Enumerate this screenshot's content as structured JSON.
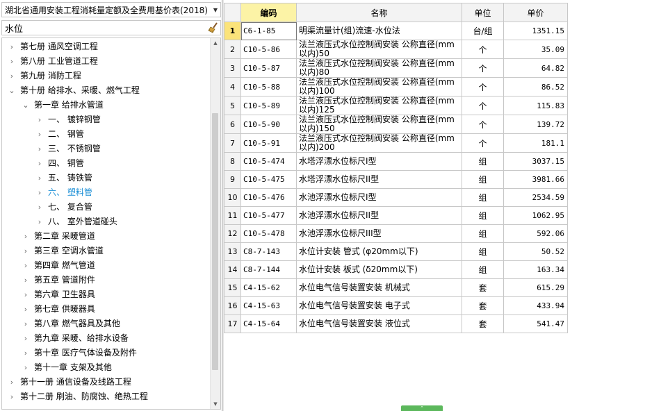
{
  "left_panel": {
    "quota_select": {
      "value": "湖北省通用安装工程消耗量定额及全费用基价表(2018)"
    },
    "search": {
      "value": "水位"
    },
    "tree": [
      {
        "label": "第七册  通风空调工程",
        "level": 0,
        "toggle": "›"
      },
      {
        "label": "第八册  工业管道工程",
        "level": 0,
        "toggle": "›"
      },
      {
        "label": "第九册  消防工程",
        "level": 0,
        "toggle": "›"
      },
      {
        "label": "第十册  给排水、采暖、燃气工程",
        "level": 0,
        "toggle": "⌄"
      },
      {
        "label": "第一章  给排水管道",
        "level": 1,
        "toggle": "⌄"
      },
      {
        "label": "一、  镀锌钢管",
        "level": 2,
        "toggle": "›"
      },
      {
        "label": "二、  钢管",
        "level": 2,
        "toggle": "›"
      },
      {
        "label": "三、  不锈钢管",
        "level": 2,
        "toggle": "›"
      },
      {
        "label": "四、  铜管",
        "level": 2,
        "toggle": "›"
      },
      {
        "label": "五、  铸铁管",
        "level": 2,
        "toggle": "›"
      },
      {
        "label": "六、  塑料管",
        "level": 2,
        "toggle": "›",
        "active": true
      },
      {
        "label": "七、  复合管",
        "level": 2,
        "toggle": "›"
      },
      {
        "label": "八、  室外管道碰头",
        "level": 2,
        "toggle": "›"
      },
      {
        "label": "第二章  采暖管道",
        "level": 1,
        "toggle": "›"
      },
      {
        "label": "第三章  空调水管道",
        "level": 1,
        "toggle": "›"
      },
      {
        "label": "第四章  燃气管道",
        "level": 1,
        "toggle": "›"
      },
      {
        "label": "第五章  管道附件",
        "level": 1,
        "toggle": "›"
      },
      {
        "label": "第六章  卫生器具",
        "level": 1,
        "toggle": "›"
      },
      {
        "label": "第七章  供暖器具",
        "level": 1,
        "toggle": "›"
      },
      {
        "label": "第八章  燃气器具及其他",
        "level": 1,
        "toggle": "›"
      },
      {
        "label": "第九章  采暖、给排水设备",
        "level": 1,
        "toggle": "›"
      },
      {
        "label": "第十章  医疗气体设备及附件",
        "level": 1,
        "toggle": "›"
      },
      {
        "label": "第十一章  支架及其他",
        "level": 1,
        "toggle": "›"
      },
      {
        "label": "第十一册  通信设备及线路工程",
        "level": 0,
        "toggle": "›"
      },
      {
        "label": "第十二册  刷油、防腐蚀、绝热工程",
        "level": 0,
        "toggle": "›"
      }
    ]
  },
  "grid": {
    "headers": {
      "index": "",
      "code": "编码",
      "name": "名称",
      "unit": "单位",
      "price": "单价"
    },
    "rows": [
      {
        "idx": "1",
        "code": "C6-1-85",
        "name": "明渠流量计(组)流速-水位法",
        "unit": "台/组",
        "price": "1351.15"
      },
      {
        "idx": "2",
        "code": "C10-5-86",
        "name": "法兰液压式水位控制阀安装 公称直径(mm以内)50",
        "unit": "个",
        "price": "35.09"
      },
      {
        "idx": "3",
        "code": "C10-5-87",
        "name": "法兰液压式水位控制阀安装 公称直径(mm以内)80",
        "unit": "个",
        "price": "64.82"
      },
      {
        "idx": "4",
        "code": "C10-5-88",
        "name": "法兰液压式水位控制阀安装 公称直径(mm以内)100",
        "unit": "个",
        "price": "86.52"
      },
      {
        "idx": "5",
        "code": "C10-5-89",
        "name": "法兰液压式水位控制阀安装 公称直径(mm以内)125",
        "unit": "个",
        "price": "115.83"
      },
      {
        "idx": "6",
        "code": "C10-5-90",
        "name": "法兰液压式水位控制阀安装 公称直径(mm以内)150",
        "unit": "个",
        "price": "139.72"
      },
      {
        "idx": "7",
        "code": "C10-5-91",
        "name": "法兰液压式水位控制阀安装 公称直径(mm以内)200",
        "unit": "个",
        "price": "181.1"
      },
      {
        "idx": "8",
        "code": "C10-5-474",
        "name": "水塔浮漂水位标尺Ⅰ型",
        "unit": "组",
        "price": "3037.15"
      },
      {
        "idx": "9",
        "code": "C10-5-475",
        "name": "水塔浮漂水位标尺II型",
        "unit": "组",
        "price": "3981.66"
      },
      {
        "idx": "10",
        "code": "C10-5-476",
        "name": "水池浮漂水位标尺Ⅰ型",
        "unit": "组",
        "price": "2534.59"
      },
      {
        "idx": "11",
        "code": "C10-5-477",
        "name": "水池浮漂水位标尺II型",
        "unit": "组",
        "price": "1062.95"
      },
      {
        "idx": "12",
        "code": "C10-5-478",
        "name": "水池浮漂水位标尺III型",
        "unit": "组",
        "price": "592.06"
      },
      {
        "idx": "13",
        "code": "C8-7-143",
        "name": "水位计安装 管式 (φ20mm以下)",
        "unit": "组",
        "price": "50.52"
      },
      {
        "idx": "14",
        "code": "C8-7-144",
        "name": "水位计安装 板式 (δ20mm以下)",
        "unit": "组",
        "price": "163.34"
      },
      {
        "idx": "15",
        "code": "C4-15-62",
        "name": "水位电气信号装置安装 机械式",
        "unit": "套",
        "price": "615.29"
      },
      {
        "idx": "16",
        "code": "C4-15-63",
        "name": "水位电气信号装置安装 电子式",
        "unit": "套",
        "price": "433.94"
      },
      {
        "idx": "17",
        "code": "C4-15-64",
        "name": "水位电气信号装置安装 液位式",
        "unit": "套",
        "price": "541.47"
      }
    ]
  },
  "colors": {
    "code_header_bg": "#fcf3a6",
    "selected_index_bg": "#fbe37a",
    "active_tree_text": "#1e90d6",
    "handle": "#5cb85c"
  },
  "icons": {
    "broom": "broom-icon",
    "dropdown": "chevron-down-icon",
    "expand": "chevron-right-icon",
    "collapse": "chevron-down-icon"
  }
}
